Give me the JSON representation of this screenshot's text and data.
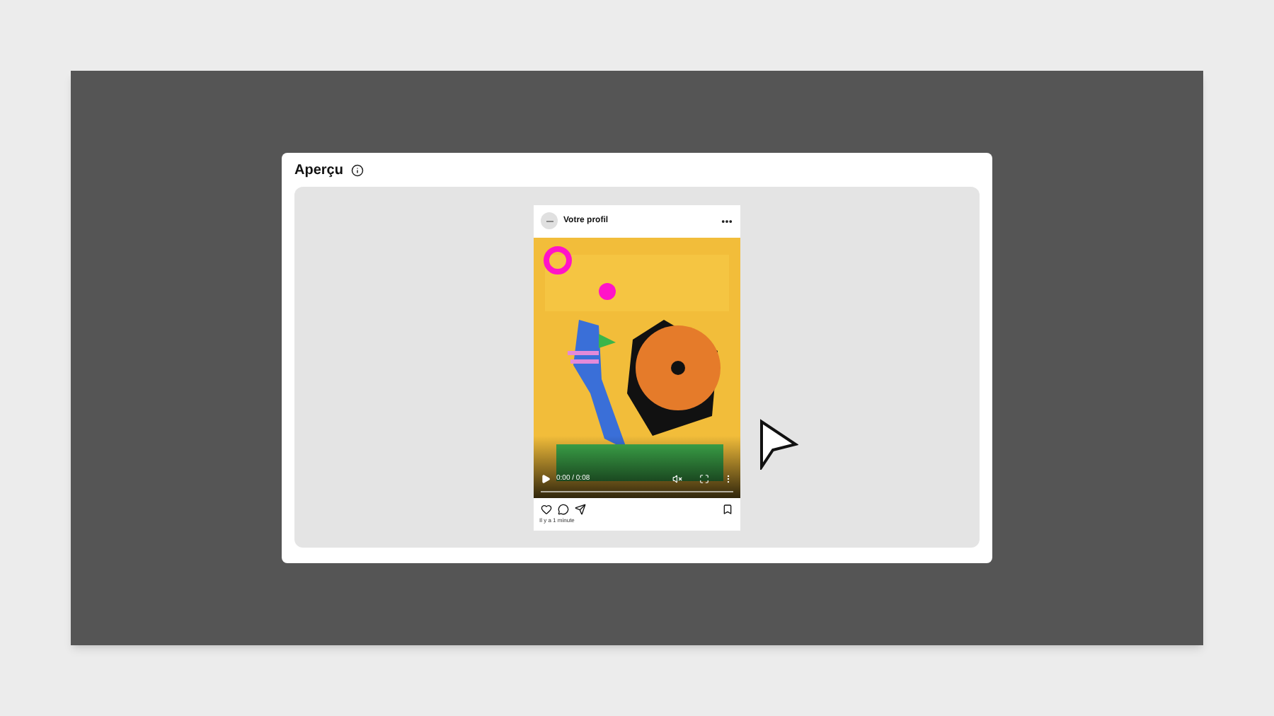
{
  "preview": {
    "title": "Aperçu"
  },
  "post": {
    "username": "Votre profil",
    "video": {
      "kind": "picture",
      "playing": false,
      "time": "0:00 / 0:08",
      "level": 0
    },
    "timestamp": "Il y a 1 minute"
  }
}
